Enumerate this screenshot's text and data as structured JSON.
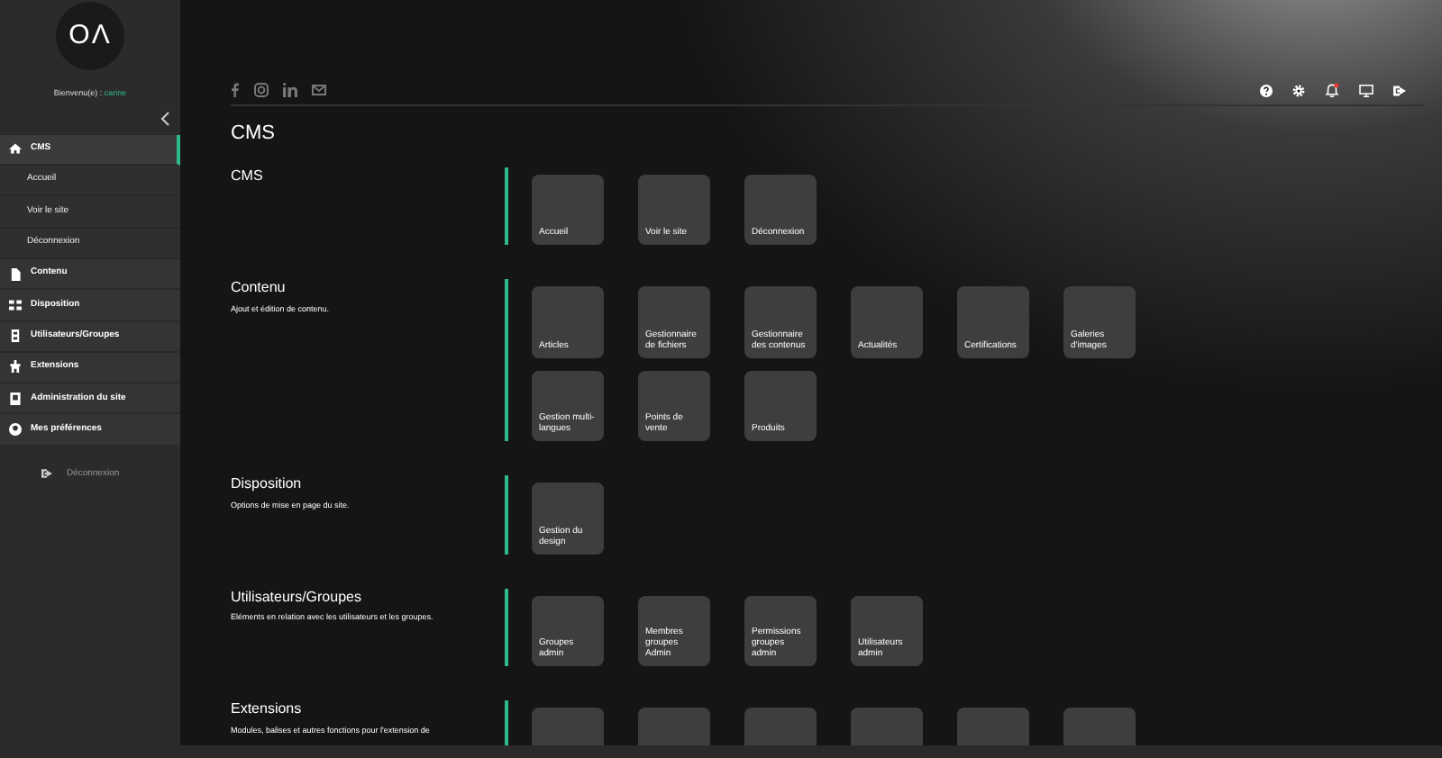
{
  "sidebar": {
    "logo": "OΛ",
    "welcome": "Bienvenu(e) :",
    "user": "carine",
    "items": [
      {
        "label": "CMS",
        "selected": true,
        "children": [
          {
            "label": "Accueil"
          },
          {
            "label": "Voir le site"
          },
          {
            "label": "Déconnexion"
          }
        ]
      },
      {
        "label": "Contenu",
        "selected": false
      },
      {
        "label": "Disposition",
        "selected": false
      },
      {
        "label": "Utilisateurs/Groupes",
        "selected": false
      },
      {
        "label": "Extensions",
        "selected": false
      },
      {
        "label": "Administration du site",
        "selected": false
      },
      {
        "label": "Mes préférences",
        "selected": false
      }
    ],
    "logout": "Déconnexion"
  },
  "page_title": "CMS",
  "sections": [
    {
      "title": "CMS",
      "tiles": [
        {
          "label": "Accueil"
        },
        {
          "label": "Voir le site"
        },
        {
          "label": "Déconnexion"
        }
      ]
    },
    {
      "title": "Contenu",
      "description": "Ajout et édition de contenu.",
      "tiles": [
        {
          "label": "Articles"
        },
        {
          "label": "Gestionnaire de fichiers"
        },
        {
          "label": "Gestionnaire des contenus"
        },
        {
          "label": "Actualités"
        },
        {
          "label": "Certifications"
        },
        {
          "label": "Galeries d'images"
        },
        {
          "label": "Gestion multi-langues"
        },
        {
          "label": "Points de vente"
        },
        {
          "label": "Produits"
        }
      ]
    },
    {
      "title": "Disposition",
      "description": "Options de mise en page du site.",
      "tiles": [
        {
          "label": "Gestion du design"
        }
      ]
    },
    {
      "title": "Utilisateurs/Groupes",
      "description": "Eléments en relation avec les utilisateurs et les groupes.",
      "tiles": [
        {
          "label": "Groupes admin"
        },
        {
          "label": "Membres groupes Admin"
        },
        {
          "label": "Permissions groupes admin"
        },
        {
          "label": "Utilisateurs admin"
        }
      ]
    },
    {
      "title": "Extensions",
      "description": "Modules, balises et autres fonctions pour l'extension de",
      "tiles": [
        {
          "kind": "cut"
        },
        {
          "kind": "cut"
        },
        {
          "kind": "cut"
        },
        {
          "kind": "cut"
        },
        {
          "kind": "cut"
        },
        {
          "kind": "cut"
        }
      ]
    }
  ]
}
